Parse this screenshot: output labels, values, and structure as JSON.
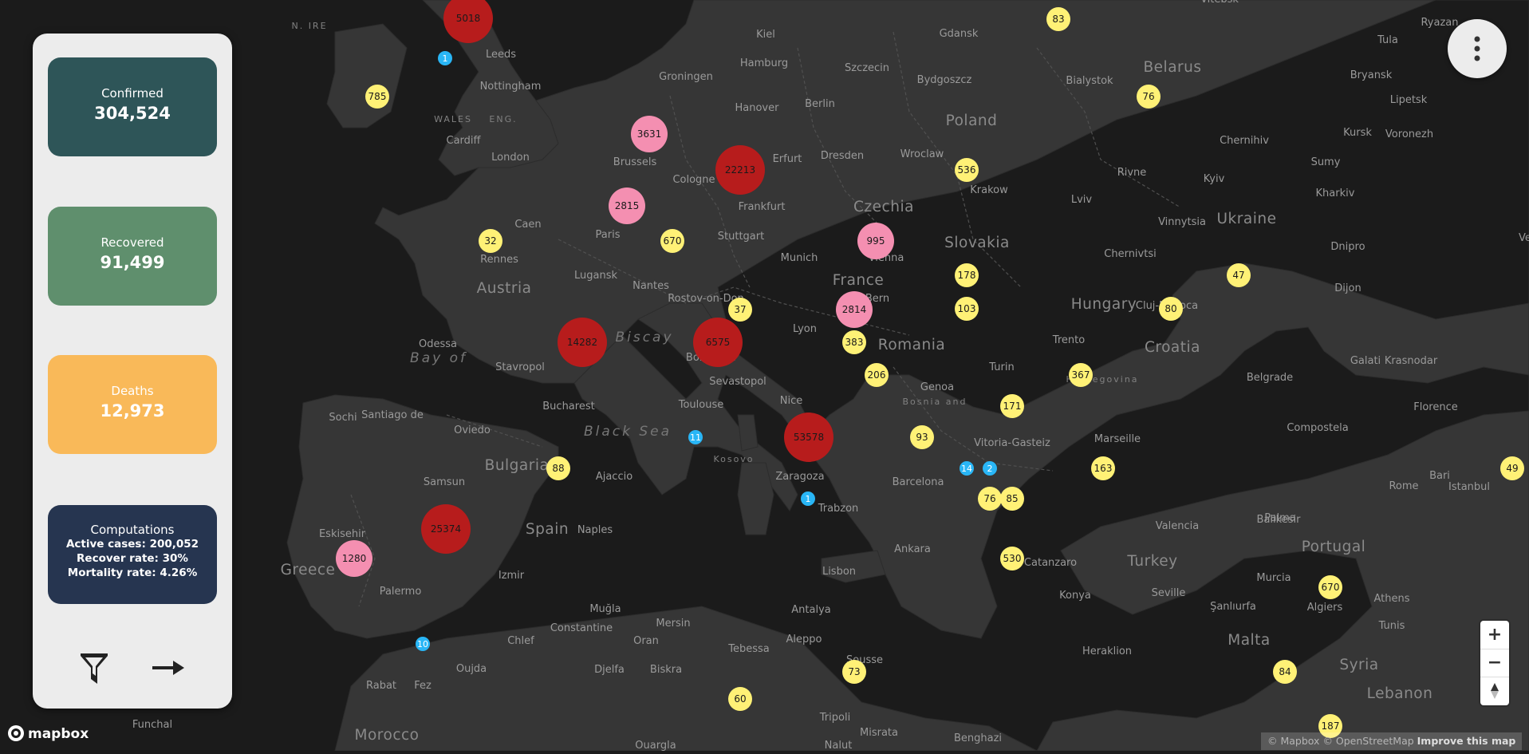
{
  "panel": {
    "confirmed": {
      "label": "Confirmed",
      "value": "304,524",
      "color": "#2e5558"
    },
    "recovered": {
      "label": "Recovered",
      "value": "91,499",
      "color": "#5f8f6d"
    },
    "deaths": {
      "label": "Deaths",
      "value": "12,973",
      "color": "#f9b959"
    },
    "computations": {
      "title": "Computations",
      "active": "Active cases: 200,052",
      "recover_rate": "Recover rate: 30%",
      "mortality_rate": "Mortality rate: 4.26%",
      "color": "#263550"
    },
    "filter_icon": "funnel-icon",
    "next_icon": "arrow-right-icon"
  },
  "menu_icon": "vertical-dots-icon",
  "zoom": {
    "in": "+",
    "out": "−",
    "compass_icon": "compass-icon"
  },
  "attribution": {
    "mapbox": "© Mapbox",
    "osm": "© OpenStreetMap",
    "improve": "Improve this map"
  },
  "logo": {
    "text": "mapbox"
  },
  "cluster_colors": {
    "large": "#b71c1c",
    "medium": "#f48fb1",
    "small": "#fff176",
    "tiny": "#29b6f6"
  },
  "clusters": [
    {
      "label": "5018",
      "size": "large"
    },
    {
      "label": "1",
      "size": "tiny"
    },
    {
      "label": "83",
      "size": "small"
    },
    {
      "label": "785",
      "size": "small"
    },
    {
      "label": "3631",
      "size": "medium"
    },
    {
      "label": "22213",
      "size": "large"
    },
    {
      "label": "76",
      "size": "small"
    },
    {
      "label": "536",
      "size": "small"
    },
    {
      "label": "2815",
      "size": "medium"
    },
    {
      "label": "32",
      "size": "small"
    },
    {
      "label": "670",
      "size": "small"
    },
    {
      "label": "995",
      "size": "medium"
    },
    {
      "label": "178",
      "size": "small"
    },
    {
      "label": "47",
      "size": "small"
    },
    {
      "label": "37",
      "size": "small"
    },
    {
      "label": "2814",
      "size": "medium"
    },
    {
      "label": "103",
      "size": "small"
    },
    {
      "label": "80",
      "size": "small"
    },
    {
      "label": "14282",
      "size": "large"
    },
    {
      "label": "6575",
      "size": "large"
    },
    {
      "label": "383",
      "size": "small"
    },
    {
      "label": "206",
      "size": "small"
    },
    {
      "label": "367",
      "size": "small"
    },
    {
      "label": "171",
      "size": "small"
    },
    {
      "label": "11",
      "size": "tiny"
    },
    {
      "label": "53578",
      "size": "large"
    },
    {
      "label": "93",
      "size": "small"
    },
    {
      "label": "14",
      "size": "tiny"
    },
    {
      "label": "2",
      "size": "tiny"
    },
    {
      "label": "163",
      "size": "small"
    },
    {
      "label": "49",
      "size": "small"
    },
    {
      "label": "88",
      "size": "small"
    },
    {
      "label": "1",
      "size": "tiny"
    },
    {
      "label": "76",
      "size": "small"
    },
    {
      "label": "85",
      "size": "small"
    },
    {
      "label": "25374",
      "size": "large"
    },
    {
      "label": "1280",
      "size": "medium"
    },
    {
      "label": "530",
      "size": "small"
    },
    {
      "label": "670",
      "size": "small"
    },
    {
      "label": "10",
      "size": "tiny"
    },
    {
      "label": "73",
      "size": "small"
    },
    {
      "label": "84",
      "size": "small"
    },
    {
      "label": "60",
      "size": "small"
    },
    {
      "label": "187",
      "size": "small"
    }
  ],
  "places": [
    {
      "name": "N. IRE",
      "kind": "region"
    },
    {
      "name": "Leeds",
      "kind": "city"
    },
    {
      "name": "Nottingham",
      "kind": "city"
    },
    {
      "name": "WALES",
      "kind": "region"
    },
    {
      "name": "ENG.",
      "kind": "region"
    },
    {
      "name": "Cardiff",
      "kind": "city"
    },
    {
      "name": "London",
      "kind": "city"
    },
    {
      "name": "Groningen",
      "kind": "city"
    },
    {
      "name": "Kiel",
      "kind": "city"
    },
    {
      "name": "Hamburg",
      "kind": "city"
    },
    {
      "name": "Gdansk",
      "kind": "city"
    },
    {
      "name": "Szczecin",
      "kind": "city"
    },
    {
      "name": "Bydgoszcz",
      "kind": "city"
    },
    {
      "name": "Bialystok",
      "kind": "city"
    },
    {
      "name": "Belarus",
      "kind": "country"
    },
    {
      "name": "Vitebsk",
      "kind": "city"
    },
    {
      "name": "Ryazan",
      "kind": "city"
    },
    {
      "name": "Tula",
      "kind": "city"
    },
    {
      "name": "Bryansk",
      "kind": "city"
    },
    {
      "name": "Lipetsk",
      "kind": "city"
    },
    {
      "name": "Hanover",
      "kind": "city"
    },
    {
      "name": "Berlin",
      "kind": "city"
    },
    {
      "name": "Poland",
      "kind": "country"
    },
    {
      "name": "Chernihiv",
      "kind": "city"
    },
    {
      "name": "Kursk",
      "kind": "city"
    },
    {
      "name": "Voronezh",
      "kind": "city"
    },
    {
      "name": "Brussels",
      "kind": "city"
    },
    {
      "name": "Cologne",
      "kind": "city"
    },
    {
      "name": "Erfurt",
      "kind": "city"
    },
    {
      "name": "Dresden",
      "kind": "city"
    },
    {
      "name": "Wroclaw",
      "kind": "city"
    },
    {
      "name": "Rivne",
      "kind": "city"
    },
    {
      "name": "Sumy",
      "kind": "city"
    },
    {
      "name": "Kyiv",
      "kind": "city"
    },
    {
      "name": "Kharkiv",
      "kind": "city"
    },
    {
      "name": "Frankfurt",
      "kind": "city"
    },
    {
      "name": "Krakow",
      "kind": "city"
    },
    {
      "name": "Lviv",
      "kind": "city"
    },
    {
      "name": "Czechia",
      "kind": "country"
    },
    {
      "name": "Caen",
      "kind": "city"
    },
    {
      "name": "Paris",
      "kind": "city"
    },
    {
      "name": "Stuttgart",
      "kind": "city"
    },
    {
      "name": "Vinnytsia",
      "kind": "city"
    },
    {
      "name": "Ukraine",
      "kind": "country"
    },
    {
      "name": "Rennes",
      "kind": "city"
    },
    {
      "name": "Slovakia",
      "kind": "country"
    },
    {
      "name": "Munich",
      "kind": "city"
    },
    {
      "name": "Vienna",
      "kind": "city"
    },
    {
      "name": "Chernivtsi",
      "kind": "city"
    },
    {
      "name": "Dnipro",
      "kind": "city"
    },
    {
      "name": "Lugansk",
      "kind": "city"
    },
    {
      "name": "France",
      "kind": "country"
    },
    {
      "name": "Austria",
      "kind": "country"
    },
    {
      "name": "Nantes",
      "kind": "city"
    },
    {
      "name": "Dijon",
      "kind": "city"
    },
    {
      "name": "Rostov-on-Don",
      "kind": "city"
    },
    {
      "name": "Bern",
      "kind": "city"
    },
    {
      "name": "Hungary",
      "kind": "country"
    },
    {
      "name": "Cluj-Napoca",
      "kind": "city"
    },
    {
      "name": "Odessa",
      "kind": "city"
    },
    {
      "name": "Bay of",
      "kind": "sea"
    },
    {
      "name": "Biscay",
      "kind": "sea"
    },
    {
      "name": "Lyon",
      "kind": "city"
    },
    {
      "name": "Trento",
      "kind": "city"
    },
    {
      "name": "Romania",
      "kind": "country"
    },
    {
      "name": "Croatia",
      "kind": "country"
    },
    {
      "name": "Galati",
      "kind": "city"
    },
    {
      "name": "Krasnodar",
      "kind": "city"
    },
    {
      "name": "Stavropol",
      "kind": "city"
    },
    {
      "name": "Bordeaux",
      "kind": "city"
    },
    {
      "name": "Turin",
      "kind": "city"
    },
    {
      "name": "Belgrade",
      "kind": "city"
    },
    {
      "name": "Sevastopol",
      "kind": "city"
    },
    {
      "name": "Genoa",
      "kind": "city"
    },
    {
      "name": "Bosnia and",
      "kind": "region"
    },
    {
      "name": "Herzegovina",
      "kind": "region"
    },
    {
      "name": "Bucharest",
      "kind": "city"
    },
    {
      "name": "Toulouse",
      "kind": "city"
    },
    {
      "name": "Nice",
      "kind": "city"
    },
    {
      "name": "Florence",
      "kind": "city"
    },
    {
      "name": "Sochi",
      "kind": "city"
    },
    {
      "name": "Santiago de",
      "kind": "city"
    },
    {
      "name": "Compostela",
      "kind": "city"
    },
    {
      "name": "Oviedo",
      "kind": "city"
    },
    {
      "name": "Black Sea",
      "kind": "sea"
    },
    {
      "name": "Vitoria-Gasteiz",
      "kind": "city"
    },
    {
      "name": "Marseille",
      "kind": "city"
    },
    {
      "name": "Kosovo",
      "kind": "region"
    },
    {
      "name": "Bulgaria",
      "kind": "country"
    },
    {
      "name": "Ajaccio",
      "kind": "city"
    },
    {
      "name": "Zaragoza",
      "kind": "city"
    },
    {
      "name": "Barcelona",
      "kind": "city"
    },
    {
      "name": "Rome",
      "kind": "city"
    },
    {
      "name": "Bari",
      "kind": "city"
    },
    {
      "name": "Istanbul",
      "kind": "city"
    },
    {
      "name": "Samsun",
      "kind": "city"
    },
    {
      "name": "Trabzon",
      "kind": "city"
    },
    {
      "name": "Spain",
      "kind": "country"
    },
    {
      "name": "Naples",
      "kind": "city"
    },
    {
      "name": "Valencia",
      "kind": "city"
    },
    {
      "name": "Palma",
      "kind": "city"
    },
    {
      "name": "Balikesir",
      "kind": "city"
    },
    {
      "name": "Eskisehir",
      "kind": "city"
    },
    {
      "name": "Ankara",
      "kind": "city"
    },
    {
      "name": "Portugal",
      "kind": "country"
    },
    {
      "name": "Catanzaro",
      "kind": "city"
    },
    {
      "name": "Turkey",
      "kind": "country"
    },
    {
      "name": "Greece",
      "kind": "country"
    },
    {
      "name": "Izmir",
      "kind": "city"
    },
    {
      "name": "Lisbon",
      "kind": "city"
    },
    {
      "name": "Murcia",
      "kind": "city"
    },
    {
      "name": "Palermo",
      "kind": "city"
    },
    {
      "name": "Konya",
      "kind": "city"
    },
    {
      "name": "Seville",
      "kind": "city"
    },
    {
      "name": "Athens",
      "kind": "city"
    },
    {
      "name": "Muğla",
      "kind": "city"
    },
    {
      "name": "Şanlıurfa",
      "kind": "city"
    },
    {
      "name": "Algiers",
      "kind": "city"
    },
    {
      "name": "Antalya",
      "kind": "city"
    },
    {
      "name": "Mersin",
      "kind": "city"
    },
    {
      "name": "Tunis",
      "kind": "city"
    },
    {
      "name": "Constantine",
      "kind": "city"
    },
    {
      "name": "Aleppo",
      "kind": "city"
    },
    {
      "name": "Chlef",
      "kind": "city"
    },
    {
      "name": "Oran",
      "kind": "city"
    },
    {
      "name": "Sousse",
      "kind": "city"
    },
    {
      "name": "Malta",
      "kind": "country"
    },
    {
      "name": "Tebessa",
      "kind": "city"
    },
    {
      "name": "Heraklion",
      "kind": "city"
    },
    {
      "name": "Oujda",
      "kind": "city"
    },
    {
      "name": "Djelfa",
      "kind": "city"
    },
    {
      "name": "Biskra",
      "kind": "city"
    },
    {
      "name": "Syria",
      "kind": "country"
    },
    {
      "name": "Rabat",
      "kind": "city"
    },
    {
      "name": "Fez",
      "kind": "city"
    },
    {
      "name": "Lebanon",
      "kind": "country"
    },
    {
      "name": "Tripoli",
      "kind": "city"
    },
    {
      "name": "Funchal",
      "kind": "city"
    },
    {
      "name": "Morocco",
      "kind": "country"
    },
    {
      "name": "Misrata",
      "kind": "city"
    },
    {
      "name": "Benghazi",
      "kind": "city"
    },
    {
      "name": "Ouargla",
      "kind": "city"
    },
    {
      "name": "Nalut",
      "kind": "city"
    },
    {
      "name": "Ve",
      "kind": "city"
    }
  ]
}
